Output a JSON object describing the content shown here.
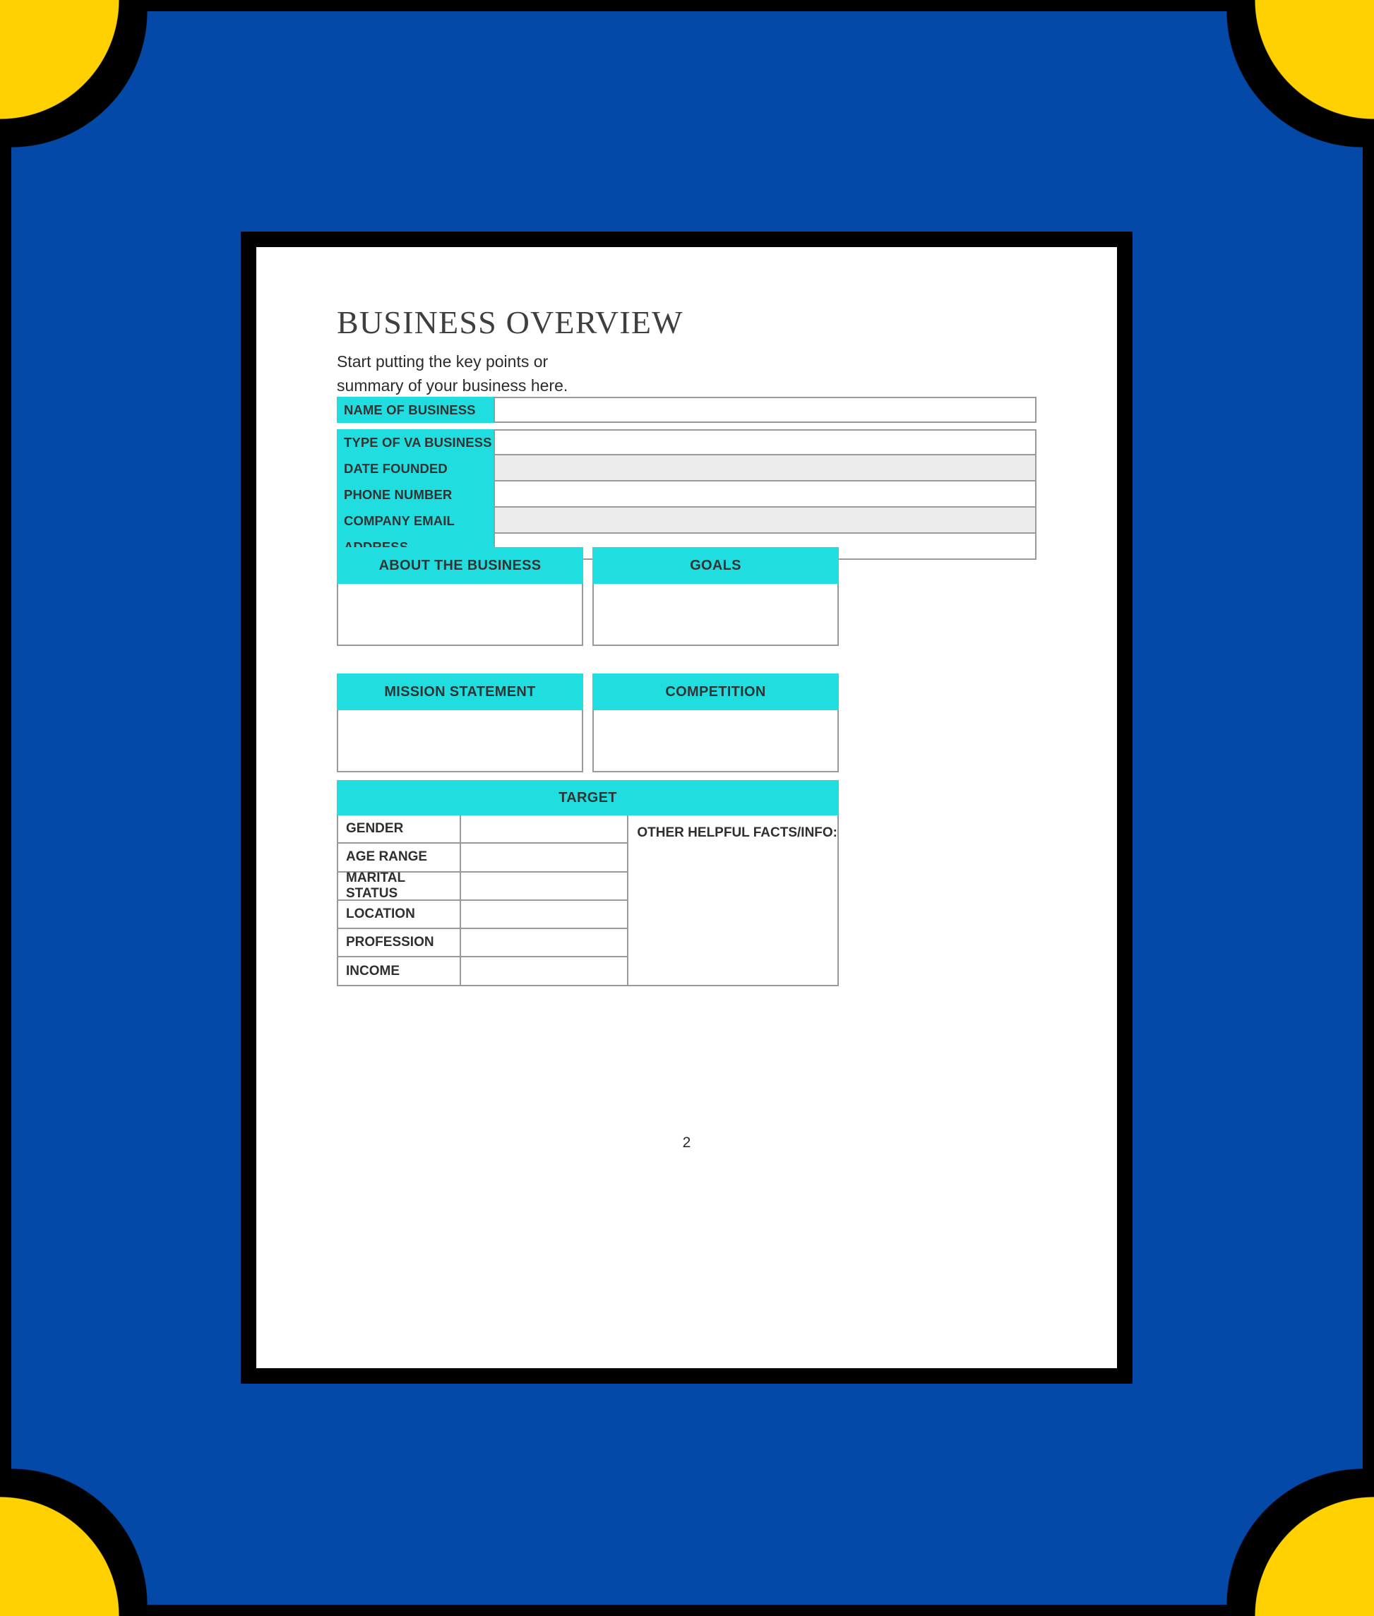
{
  "theme": {
    "background_blue": "#0449A8",
    "corner_yellow": "#FFD100",
    "frame_black": "#000000",
    "accent_cyan": "#20DEE0",
    "field_border": "#9a9a9a",
    "field_shaded": "#ececec",
    "page_white": "#ffffff"
  },
  "document": {
    "title": "BUSINESS OVERVIEW",
    "subtitle": "Start putting the key points or\nsummary of your business here.",
    "page_number": "2"
  },
  "info_fields": {
    "primary": [
      {
        "label": "NAME OF BUSINESS",
        "value": "",
        "shaded": false
      }
    ],
    "secondary": [
      {
        "label": "TYPE OF VA BUSINESS",
        "value": "",
        "shaded": false
      },
      {
        "label": "DATE FOUNDED",
        "value": "",
        "shaded": true
      },
      {
        "label": "PHONE NUMBER",
        "value": "",
        "shaded": false
      },
      {
        "label": "COMPANY EMAIL",
        "value": "",
        "shaded": true
      },
      {
        "label": "ADDRESS",
        "value": "",
        "shaded": false
      }
    ]
  },
  "sections": [
    {
      "heading": "ABOUT THE BUSINESS",
      "body": ""
    },
    {
      "heading": "GOALS",
      "body": ""
    },
    {
      "heading": "MISSION STATEMENT",
      "body": ""
    },
    {
      "heading": "COMPETITION",
      "body": ""
    }
  ],
  "target": {
    "heading": "TARGET",
    "rows": [
      {
        "key": "GENDER",
        "value": ""
      },
      {
        "key": "AGE RANGE",
        "value": ""
      },
      {
        "key": "MARITAL STATUS",
        "value": ""
      },
      {
        "key": "LOCATION",
        "value": ""
      },
      {
        "key": "PROFESSION",
        "value": ""
      },
      {
        "key": "INCOME",
        "value": ""
      }
    ],
    "other_label": "OTHER HELPFUL FACTS/INFO:",
    "other_value": ""
  }
}
